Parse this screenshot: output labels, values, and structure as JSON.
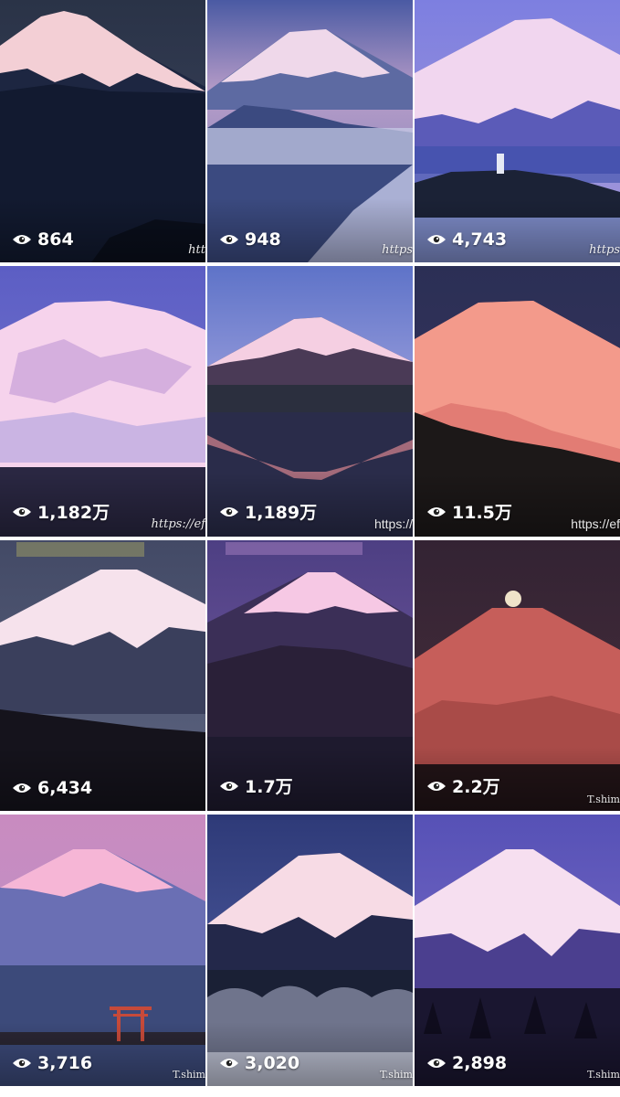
{
  "tiles": [
    {
      "views": "864",
      "watermark": "htt",
      "colors": {
        "sky_top": "#2a3347",
        "sky_bot": "#3d4560",
        "snow": "#f2cfd6",
        "mount": "#1b2440",
        "ground": "#0e1528"
      }
    },
    {
      "views": "948",
      "watermark": "https",
      "colors": {
        "sky_top": "#4a5aa3",
        "sky_bot": "#b79cc8",
        "snow": "#eed7ea",
        "mount": "#5d6aa2",
        "ground": "#2e3f6e"
      }
    },
    {
      "views": "4,743",
      "watermark": "https",
      "colors": {
        "sky_top": "#7d7fe0",
        "sky_bot": "#a79ad8",
        "snow": "#f0d6f0",
        "mount": "#5b5bb8",
        "ground": "#1c2338"
      }
    },
    {
      "views": "1,182万",
      "watermark": "https://ef",
      "colors": {
        "sky_top": "#5c5ec4",
        "sky_bot": "#7c7bd1",
        "snow": "#f6d3ec",
        "mount": "#b99ad6",
        "ground": "#2a2742"
      }
    },
    {
      "views": "1,189万",
      "watermark": "https://",
      "colors": {
        "sky_top": "#5e73c8",
        "sky_bot": "#9a9edc",
        "snow": "#f5cfe2",
        "mount": "#4a3a56",
        "ground": "#2a2c4a"
      }
    },
    {
      "views": "11.5万",
      "watermark": "https://ef",
      "colors": {
        "sky_top": "#2b2f55",
        "sky_bot": "#3b3660",
        "snow": "#f39a8b",
        "mount": "#e27c74",
        "ground": "#1c1818"
      }
    },
    {
      "views": "6,434",
      "watermark": "",
      "colors": {
        "sky_top": "#434a66",
        "sky_bot": "#5d6480",
        "snow": "#f6e2ec",
        "mount": "#3a3f5c",
        "ground": "#15131c"
      }
    },
    {
      "views": "1.7万",
      "watermark": "",
      "colors": {
        "sky_top": "#4d3f83",
        "sky_bot": "#7a5ea4",
        "snow": "#f6c8e4",
        "mount": "#3b2f57",
        "ground": "#1e1a2e"
      }
    },
    {
      "views": "2.2万",
      "watermark": "T.shim",
      "colors": {
        "sky_top": "#332333",
        "sky_bot": "#4a2f3d",
        "snow": "#c65e5a",
        "mount": "#a94b48",
        "ground": "#221417"
      }
    },
    {
      "views": "3,716",
      "watermark": "T.shim",
      "colors": {
        "sky_top": "#c98bc0",
        "sky_bot": "#b893c8",
        "snow": "#f6b6d6",
        "mount": "#6a6fb4",
        "ground": "#3c4a7a"
      }
    },
    {
      "views": "3,020",
      "watermark": "T.shim",
      "colors": {
        "sky_top": "#2e3a78",
        "sky_bot": "#5764aa",
        "snow": "#f7dbe5",
        "mount": "#23284a",
        "ground": "#1a2035"
      }
    },
    {
      "views": "2,898",
      "watermark": "T.shim",
      "colors": {
        "sky_top": "#5651b6",
        "sky_bot": "#8272c9",
        "snow": "#f6dff0",
        "mount": "#4b3f8f",
        "ground": "#1a1630"
      }
    }
  ]
}
